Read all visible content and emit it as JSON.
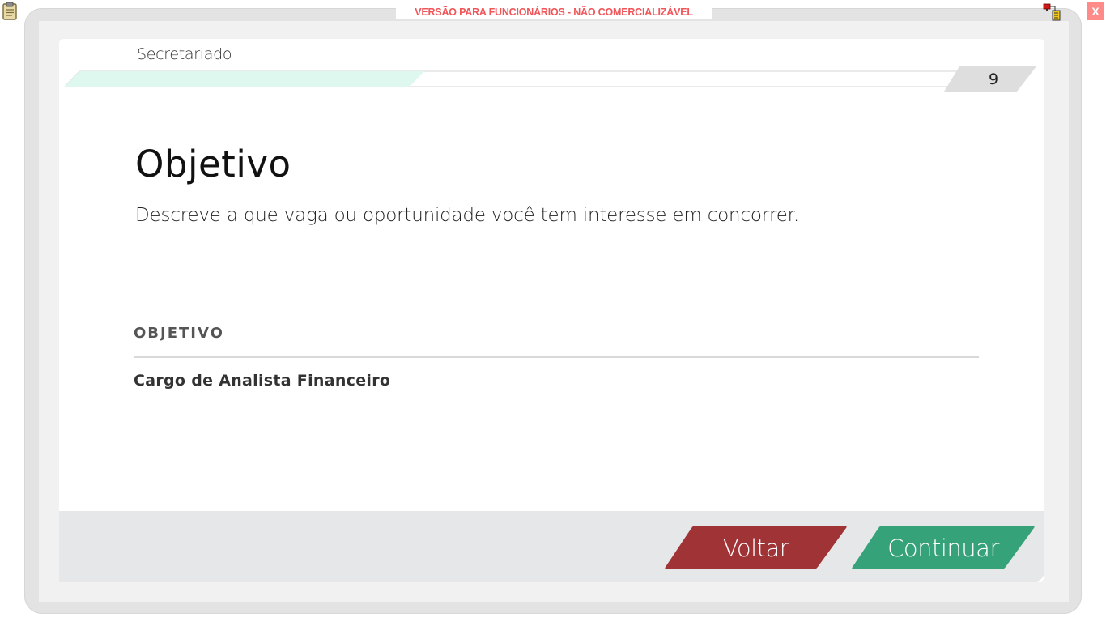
{
  "banner": {
    "text": "VERSÃO PARA FUNCIONÁRIOS - NÃO COMERCIALIZÁVEL"
  },
  "window": {
    "close_label": "X"
  },
  "header": {
    "course_title": "Secretariado",
    "page_number": "9"
  },
  "progress": {
    "fraction": 0.39
  },
  "main": {
    "heading": "Objetivo",
    "description": "Descreve a que vaga ou oportunidade você tem interesse em concorrer."
  },
  "section": {
    "label": "OBJETIVO",
    "value": "Cargo de Analista Financeiro"
  },
  "footer": {
    "back_label": "Voltar",
    "next_label": "Continuar"
  },
  "colors": {
    "back_button": "#a03336",
    "next_button": "#36a27a",
    "progress_fill": "#def7ef",
    "banner_text": "#f0565a"
  },
  "icons": [
    "clipboard-icon",
    "network-status-icon",
    "close-icon"
  ]
}
